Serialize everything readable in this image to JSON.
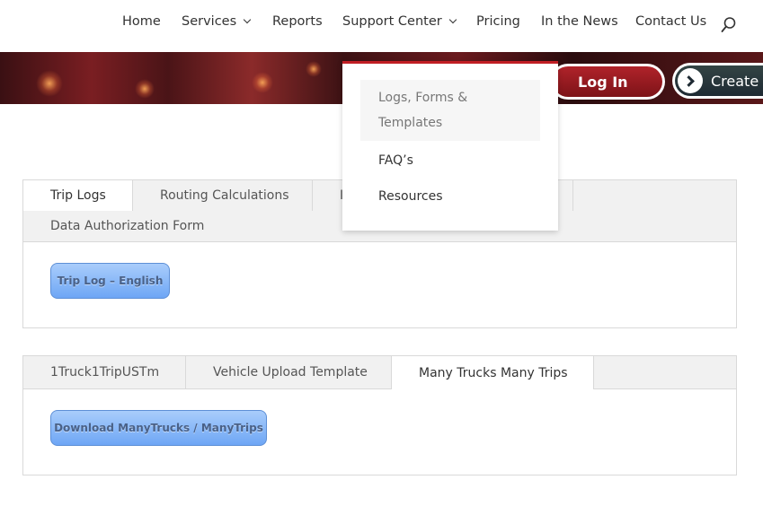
{
  "nav": {
    "home": "Home",
    "services": "Services",
    "reports": "Reports",
    "support_center": "Support Center",
    "pricing": "Pricing",
    "in_the_news": "In the News",
    "contact_us": "Contact Us"
  },
  "banner": {
    "login_label": "Log In",
    "create_label": "Create A"
  },
  "dropdown": {
    "items": [
      "Logs, Forms & Templates",
      "FAQ’s",
      "Resources"
    ]
  },
  "tabs1": {
    "tabs": [
      "Trip Logs",
      "Routing Calculations",
      "I",
      "Data Authorization Form"
    ],
    "active": "Trip Logs",
    "button_label": "Trip Log – English"
  },
  "tabs2": {
    "tabs": [
      "1Truck1TripUSTm",
      "Vehicle Upload Template",
      "Many Trucks Many Trips"
    ],
    "active": "Many Trucks Many Trips",
    "button_label": "Download ManyTrucks / ManyTrips"
  },
  "colors": {
    "accent_red": "#c11e24",
    "button_blue": "#6ea6f5"
  }
}
